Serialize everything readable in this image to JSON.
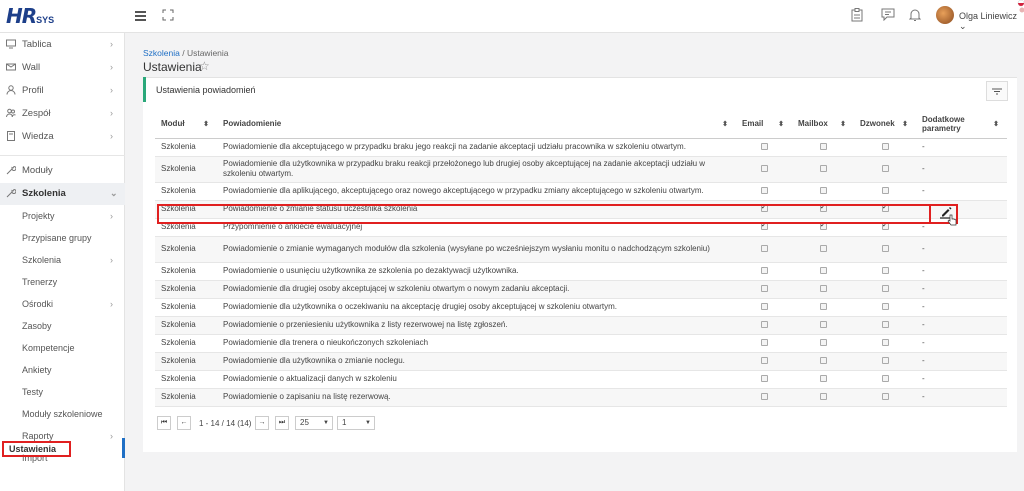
{
  "app": {
    "logo_hr": "HR",
    "logo_sys": "SYS"
  },
  "header": {
    "user_name": "Olga Liniewicz ⌄"
  },
  "sidebar": {
    "items": [
      {
        "label": "Tablica",
        "icon": "monitor-icon",
        "chev": "›"
      },
      {
        "label": "Wall",
        "icon": "wall-icon",
        "chev": "›"
      },
      {
        "label": "Profil",
        "icon": "user-icon",
        "chev": "›"
      },
      {
        "label": "Zespół",
        "icon": "team-icon",
        "chev": "›"
      },
      {
        "label": "Wiedza",
        "icon": "book-icon",
        "chev": "›"
      },
      {
        "label": "Moduły",
        "icon": "wrench-icon",
        "chev": ""
      },
      {
        "label": "Szkolenia",
        "icon": "wrench-icon",
        "chev": "⌄"
      }
    ],
    "sub_items": [
      {
        "label": "Projekty",
        "chev": "›"
      },
      {
        "label": "Przypisane grupy",
        "chev": ""
      },
      {
        "label": "Szkolenia",
        "chev": "›"
      },
      {
        "label": "Trenerzy",
        "chev": ""
      },
      {
        "label": "Ośrodki",
        "chev": "›"
      },
      {
        "label": "Zasoby",
        "chev": ""
      },
      {
        "label": "Kompetencje",
        "chev": ""
      },
      {
        "label": "Ankiety",
        "chev": ""
      },
      {
        "label": "Testy",
        "chev": ""
      },
      {
        "label": "Moduły szkoleniowe",
        "chev": ""
      },
      {
        "label": "Raporty",
        "chev": "›"
      },
      {
        "label": "Import",
        "chev": ""
      },
      {
        "label": "Ustawienia",
        "chev": ""
      }
    ]
  },
  "breadcrumb": {
    "link": "Szkolenia",
    "sep": " / ",
    "current": "Ustawienia"
  },
  "page": {
    "title": "Ustawienia"
  },
  "panel": {
    "title": "Ustawienia powiadomień"
  },
  "table": {
    "headers": {
      "modul": "Moduł",
      "powiadomienie": "Powiadomienie",
      "email": "Email",
      "mailbox": "Mailbox",
      "dzwonek": "Dzwonek",
      "dodatkowe": "Dodatkowe parametry"
    },
    "rows": [
      {
        "modul": "Szkolenia",
        "text": "Powiadomienie dla akceptującego w przypadku braku jego reakcji na zadanie akceptacji udziału pracownika w szkoleniu otwartym.",
        "email": false,
        "mailbox": false,
        "dzwonek": false,
        "extra": "-"
      },
      {
        "modul": "Szkolenia",
        "text": "Powiadomienie dla użytkownika w przypadku braku reakcji przełożonego lub drugiej osoby akceptującej na zadanie akceptacji udziału w szkoleniu otwartym.",
        "email": false,
        "mailbox": false,
        "dzwonek": false,
        "extra": "-"
      },
      {
        "modul": "Szkolenia",
        "text": "Powiadomienie dla aplikującego, akceptującego oraz nowego akceptującego w przypadku zmiany akceptującego w szkoleniu otwartym.",
        "email": false,
        "mailbox": false,
        "dzwonek": false,
        "extra": "-"
      },
      {
        "modul": "Szkolenia",
        "text": "Powiadomienie o zmianie statusu uczestnika szkolenia",
        "email": true,
        "mailbox": true,
        "dzwonek": true,
        "extra": ""
      },
      {
        "modul": "Szkolenia",
        "text": "Przypomnienie o ankiecie ewaluacyjnej",
        "email": true,
        "mailbox": true,
        "dzwonek": true,
        "extra": "-"
      },
      {
        "modul": "Szkolenia",
        "text": "Powiadomienie o zmianie wymaganych modułów dla szkolenia (wysyłane po wcześniejszym wysłaniu monitu o nadchodzącym szkoleniu)",
        "email": false,
        "mailbox": false,
        "dzwonek": false,
        "extra": "-"
      },
      {
        "modul": "Szkolenia",
        "text": "Powiadomienie o usunięciu użytkownika ze szkolenia po dezaktywacji użytkownika.",
        "email": false,
        "mailbox": false,
        "dzwonek": false,
        "extra": "-"
      },
      {
        "modul": "Szkolenia",
        "text": "Powiadomienie dla drugiej osoby akceptującej w szkoleniu otwartym o nowym zadaniu akceptacji.",
        "email": false,
        "mailbox": false,
        "dzwonek": false,
        "extra": "-"
      },
      {
        "modul": "Szkolenia",
        "text": "Powiadomienie dla użytkownika o oczekiwaniu na akceptację drugiej osoby akceptującej w szkoleniu otwartym.",
        "email": false,
        "mailbox": false,
        "dzwonek": false,
        "extra": "-"
      },
      {
        "modul": "Szkolenia",
        "text": "Powiadomienie o przeniesieniu użytkownika z listy rezerwowej na listę zgłoszeń.",
        "email": false,
        "mailbox": false,
        "dzwonek": false,
        "extra": "-"
      },
      {
        "modul": "Szkolenia",
        "text": "Powiadomienie dla trenera o nieukończonych szkoleniach",
        "email": false,
        "mailbox": false,
        "dzwonek": false,
        "extra": "-"
      },
      {
        "modul": "Szkolenia",
        "text": "Powiadomienie dla użytkownika o zmianie noclegu.",
        "email": false,
        "mailbox": false,
        "dzwonek": false,
        "extra": "-"
      },
      {
        "modul": "Szkolenia",
        "text": "Powiadomienie o aktualizacji danych w szkoleniu",
        "email": false,
        "mailbox": false,
        "dzwonek": false,
        "extra": "-"
      },
      {
        "modul": "Szkolenia",
        "text": "Powiadomienie o zapisaniu na listę rezerwową.",
        "email": false,
        "mailbox": false,
        "dzwonek": false,
        "extra": "-"
      }
    ]
  },
  "pager": {
    "first": "⏮",
    "prev": "←",
    "next": "→",
    "last": "⏭",
    "range_text": "1 - 14 / 14 (14)",
    "page_size": "25",
    "page": "1"
  }
}
